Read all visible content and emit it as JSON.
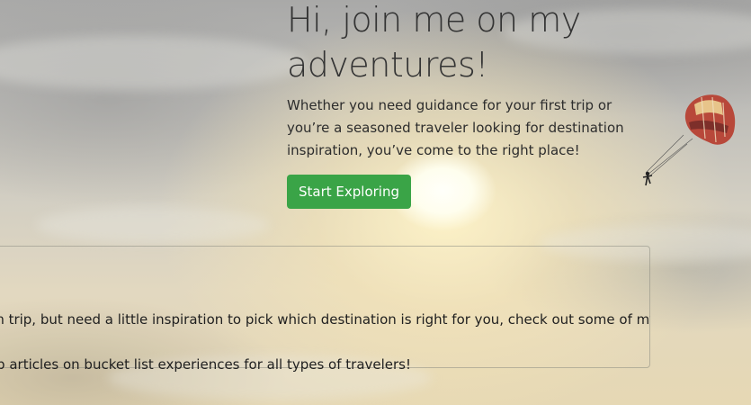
{
  "hero": {
    "title": "Hi, join me on my adventures!",
    "subtitle": "Whether you need guidance for your first trip or you’re a seasoned traveler looking for destination inspiration, you’ve come to the right place!",
    "cta_label": "Start Exploring"
  },
  "info_card": {
    "line1": "am trip, but need a little inspiration to pick which destination is right for you, check out some of my",
    "line2": "top articles on bucket list experiences for all types of travelers!"
  },
  "colors": {
    "cta_background": "#3aa447",
    "cta_text": "#ffffff",
    "heading_text": "#333333"
  },
  "decor": {
    "background_icon": "sunset-sky-paraglider"
  }
}
